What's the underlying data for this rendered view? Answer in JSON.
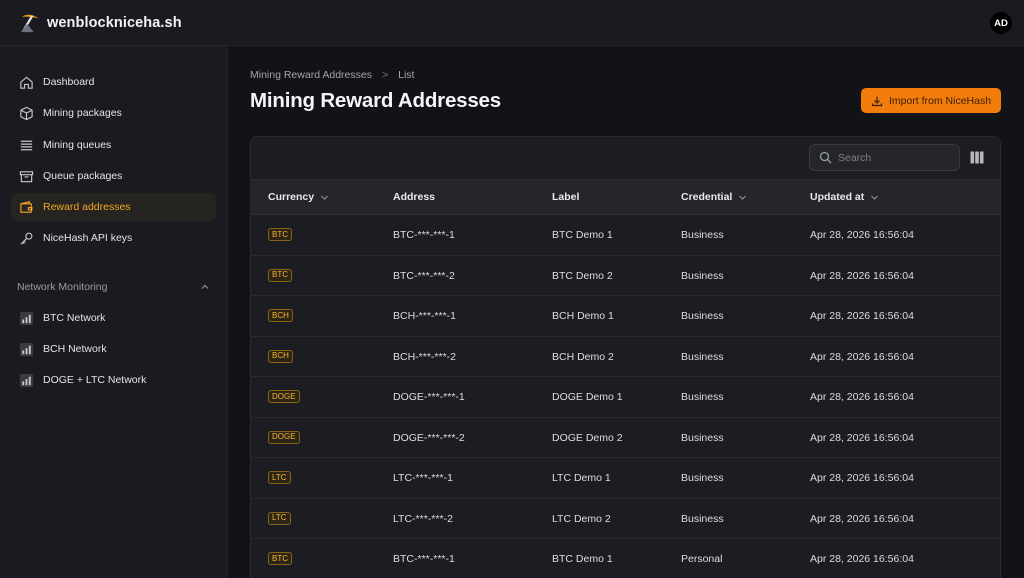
{
  "app": {
    "name": "wenblockniceha.sh",
    "user_initials": "AD"
  },
  "colors": {
    "accent": "#f5a524",
    "button": "#f27c0c",
    "background": "#121317"
  },
  "sidebar": {
    "items": [
      {
        "label": "Dashboard",
        "icon": "home-icon",
        "active": false
      },
      {
        "label": "Mining packages",
        "icon": "package-icon",
        "active": false
      },
      {
        "label": "Mining queues",
        "icon": "queue-list-icon",
        "active": false
      },
      {
        "label": "Queue packages",
        "icon": "archive-box-icon",
        "active": false
      },
      {
        "label": "Reward addresses",
        "icon": "wallet-icon",
        "active": true
      },
      {
        "label": "NiceHash API keys",
        "icon": "key-icon",
        "active": false
      }
    ],
    "section": {
      "label": "Network Monitoring",
      "expanded": true
    },
    "network_items": [
      {
        "label": "BTC Network",
        "icon": "signal-bars-icon"
      },
      {
        "label": "BCH Network",
        "icon": "signal-bars-icon"
      },
      {
        "label": "DOGE + LTC Network",
        "icon": "signal-bars-icon"
      }
    ]
  },
  "breadcrumb": {
    "parent": "Mining Reward Addresses",
    "separator": ">",
    "current": "List"
  },
  "page": {
    "title": "Mining Reward Addresses",
    "import_label": "Import from NiceHash"
  },
  "table": {
    "search_placeholder": "Search",
    "columns": [
      "Currency",
      "Address",
      "Label",
      "Credential",
      "Updated at"
    ],
    "rows": [
      {
        "currency": "BTC",
        "address": "BTC-***-***-1",
        "label": "BTC Demo 1",
        "credential": "Business",
        "updated": "Apr 28, 2026 16:56:04"
      },
      {
        "currency": "BTC",
        "address": "BTC-***-***-2",
        "label": "BTC Demo 2",
        "credential": "Business",
        "updated": "Apr 28, 2026 16:56:04"
      },
      {
        "currency": "BCH",
        "address": "BCH-***-***-1",
        "label": "BCH Demo 1",
        "credential": "Business",
        "updated": "Apr 28, 2026 16:56:04"
      },
      {
        "currency": "BCH",
        "address": "BCH-***-***-2",
        "label": "BCH Demo 2",
        "credential": "Business",
        "updated": "Apr 28, 2026 16:56:04"
      },
      {
        "currency": "DOGE",
        "address": "DOGE-***-***-1",
        "label": "DOGE Demo 1",
        "credential": "Business",
        "updated": "Apr 28, 2026 16:56:04"
      },
      {
        "currency": "DOGE",
        "address": "DOGE-***-***-2",
        "label": "DOGE Demo 2",
        "credential": "Business",
        "updated": "Apr 28, 2026 16:56:04"
      },
      {
        "currency": "LTC",
        "address": "LTC-***-***-1",
        "label": "LTC Demo 1",
        "credential": "Business",
        "updated": "Apr 28, 2026 16:56:04"
      },
      {
        "currency": "LTC",
        "address": "LTC-***-***-2",
        "label": "LTC Demo 2",
        "credential": "Business",
        "updated": "Apr 28, 2026 16:56:04"
      },
      {
        "currency": "BTC",
        "address": "BTC-***-***-1",
        "label": "BTC Demo 1",
        "credential": "Personal",
        "updated": "Apr 28, 2026 16:56:04"
      }
    ]
  }
}
